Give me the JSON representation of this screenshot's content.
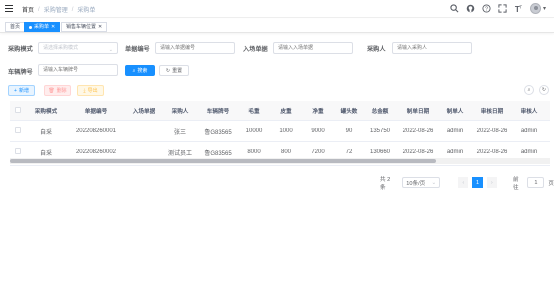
{
  "breadcrumb": [
    "首页",
    "采购管理",
    "采购单"
  ],
  "header_icons": [
    "search-icon",
    "github-icon",
    "help-icon",
    "fullscreen-icon",
    "font-size-icon",
    "avatar"
  ],
  "tags": [
    {
      "label": "首页",
      "active": false
    },
    {
      "label": "采购单",
      "active": true,
      "closable": true
    },
    {
      "label": "销售车辆位置",
      "active": false,
      "closable": true
    }
  ],
  "search": {
    "purchase_mode": {
      "label": "采购模式",
      "placeholder": "请选择采购模式"
    },
    "order_no": {
      "label": "单据编号",
      "placeholder": "请输入单据编号"
    },
    "entry_unit": {
      "label": "入场单据",
      "placeholder": "请输入入场单据"
    },
    "purchaser": {
      "label": "采购人",
      "placeholder": "请输入采购人"
    },
    "plate_no": {
      "label": "车辆牌号",
      "placeholder": "请输入车辆牌号"
    },
    "search_btn": "搜索",
    "reset_btn": "重置"
  },
  "toolbar": {
    "add": "新增",
    "edit": "修改",
    "delete": "删除",
    "export": "导出"
  },
  "table": {
    "columns": [
      "",
      "采购模式",
      "单据编号",
      "入场单据",
      "采购人",
      "车辆牌号",
      "毛重",
      "皮重",
      "净重",
      "罐头数",
      "总金额",
      "制单日期",
      "制单人",
      "审核日期",
      "审核人",
      "操作"
    ],
    "rows": [
      [
        "",
        "自采",
        "202208260001",
        "",
        "张三",
        "鲁G83565",
        "10000",
        "1000",
        "9000",
        "90",
        "135750",
        "2022-08-26",
        "admin",
        "2022-08-26",
        "admin",
        "修改"
      ],
      [
        "",
        "自采",
        "202208260002",
        "",
        "测试员工",
        "鲁G83565",
        "8000",
        "800",
        "7200",
        "72",
        "130660",
        "2022-08-26",
        "admin",
        "2022-08-26",
        "admin",
        "修改"
      ]
    ]
  },
  "pagination": {
    "total_text": "共 2 条",
    "page_size": "10条/页",
    "current_page": "1",
    "goto_label": "前往",
    "goto_value": "1",
    "page_unit": "页"
  },
  "colors": {
    "primary": "#1890ff",
    "danger": "#ff9a9a",
    "warning": "#ffc14d"
  }
}
